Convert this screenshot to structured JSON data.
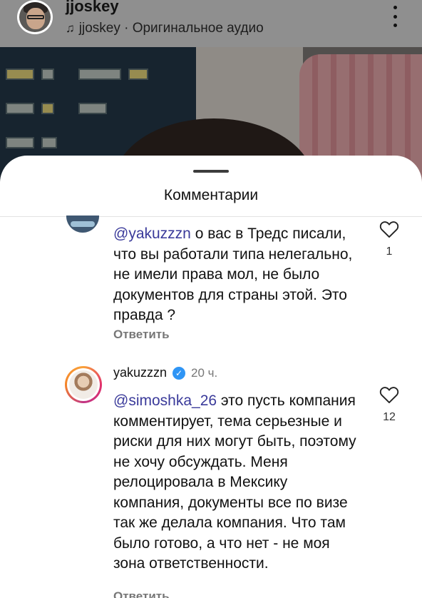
{
  "reel": {
    "username": "jjoskey",
    "audio_label": "jjoskey · Оригинальное аудио",
    "music_icon": "music-note-icon",
    "more_icon": "more-vertical-icon"
  },
  "sheet": {
    "title": "Комментарии"
  },
  "comments": [
    {
      "mention": "@yakuzzzn",
      "text": " о вас в Тредс писали, что вы работали типа нелегально, не имели права мол, не было документов для страны этой. Это правда ?",
      "reply_label": "Ответить",
      "likes": "1"
    },
    {
      "username": "yakuzzzn",
      "time": "20 ч.",
      "verified": true,
      "mention": "@simoshka_26",
      "text": " это пусть компания комментирует, тема серьезные и риски для них могут быть, поэтому не хочу обсуждать. Меня релоцировала в Мексику компания, документы все по визе так же делала компания. Что там было готово, а что нет - не моя зона ответственности.",
      "reply_label": "Ответить",
      "likes": "12"
    }
  ],
  "colors": {
    "mention": "#3a3a9a",
    "verified_badge": "#2f95f5",
    "secondary_text": "#777777"
  }
}
